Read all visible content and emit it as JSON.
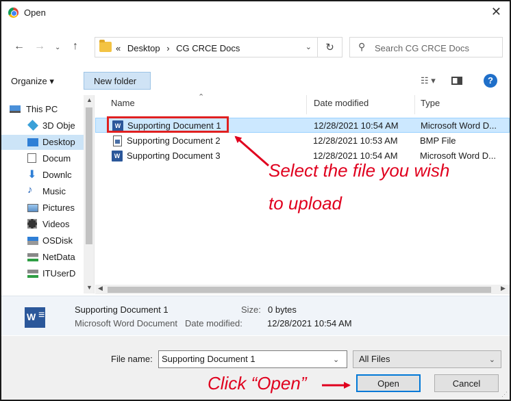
{
  "window": {
    "title": "Open"
  },
  "nav": {
    "breadcrumb": [
      "«",
      "Desktop",
      "›",
      "CG CRCE Docs"
    ],
    "search_placeholder": "Search CG CRCE Docs"
  },
  "toolbar": {
    "organize_label": "Organize ▾",
    "new_folder_label": "New folder"
  },
  "sidebar": {
    "items": [
      {
        "label": "This PC",
        "icon": "pc-icon"
      },
      {
        "label": "3D Obje",
        "icon": "cube-icon"
      },
      {
        "label": "Desktop",
        "icon": "desktop-icon"
      },
      {
        "label": "Docum",
        "icon": "document-icon"
      },
      {
        "label": "Downlc",
        "icon": "download-icon"
      },
      {
        "label": "Music",
        "icon": "music-icon"
      },
      {
        "label": "Pictures",
        "icon": "pictures-icon"
      },
      {
        "label": "Videos",
        "icon": "videos-icon"
      },
      {
        "label": "OSDisk",
        "icon": "disk-icon"
      },
      {
        "label": "NetData",
        "icon": "network-drive-icon"
      },
      {
        "label": "ITUserD",
        "icon": "network-drive-icon"
      }
    ]
  },
  "file_list": {
    "columns": {
      "name": "Name",
      "date": "Date modified",
      "type": "Type"
    },
    "rows": [
      {
        "name": "Supporting Document 1",
        "date": "12/28/2021 10:54 AM",
        "type": "Microsoft Word D...",
        "icon": "word-doc-icon"
      },
      {
        "name": "Supporting Document 2",
        "date": "12/28/2021 10:53 AM",
        "type": "BMP File",
        "icon": "bmp-file-icon"
      },
      {
        "name": "Supporting Document 3",
        "date": "12/28/2021 10:54 AM",
        "type": "Microsoft Word D...",
        "icon": "word-doc-icon"
      }
    ]
  },
  "details": {
    "name": "Supporting Document 1",
    "size_label": "Size:",
    "size_value": "0 bytes",
    "type_value": "Microsoft Word Document",
    "date_label": "Date modified:",
    "date_value": "12/28/2021 10:54 AM"
  },
  "bottom": {
    "filename_label": "File name:",
    "filename_value": "Supporting Document 1",
    "filetype_value": "All Files",
    "open_label": "Open",
    "cancel_label": "Cancel"
  },
  "annotations": {
    "select_line1": "Select the file you wish",
    "select_line2": "to upload",
    "click_open": "Click “Open”"
  },
  "colors": {
    "accent": "#0078d7",
    "annotation": "#e0001e",
    "selection": "#cce8ff"
  }
}
